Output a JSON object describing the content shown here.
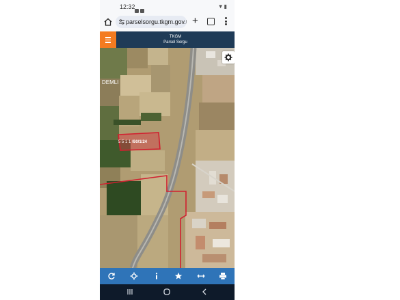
{
  "status_bar": {
    "time": "12:32"
  },
  "browser": {
    "url": "parselsorgu.tkgm.gov.tr"
  },
  "app": {
    "org": "TKGM",
    "title": "Parsel Sorgu"
  },
  "map": {
    "place_label": "DEMLI",
    "parcel_label": "60/1/24",
    "parcel_label_left": "5 5 1 1 0"
  },
  "toolbar": {
    "items": [
      "refresh-icon",
      "locate-icon",
      "info-icon",
      "star-icon",
      "measure-icon",
      "print-icon"
    ]
  },
  "nav": {
    "items": [
      "recents-icon",
      "home-icon",
      "back-icon"
    ]
  }
}
